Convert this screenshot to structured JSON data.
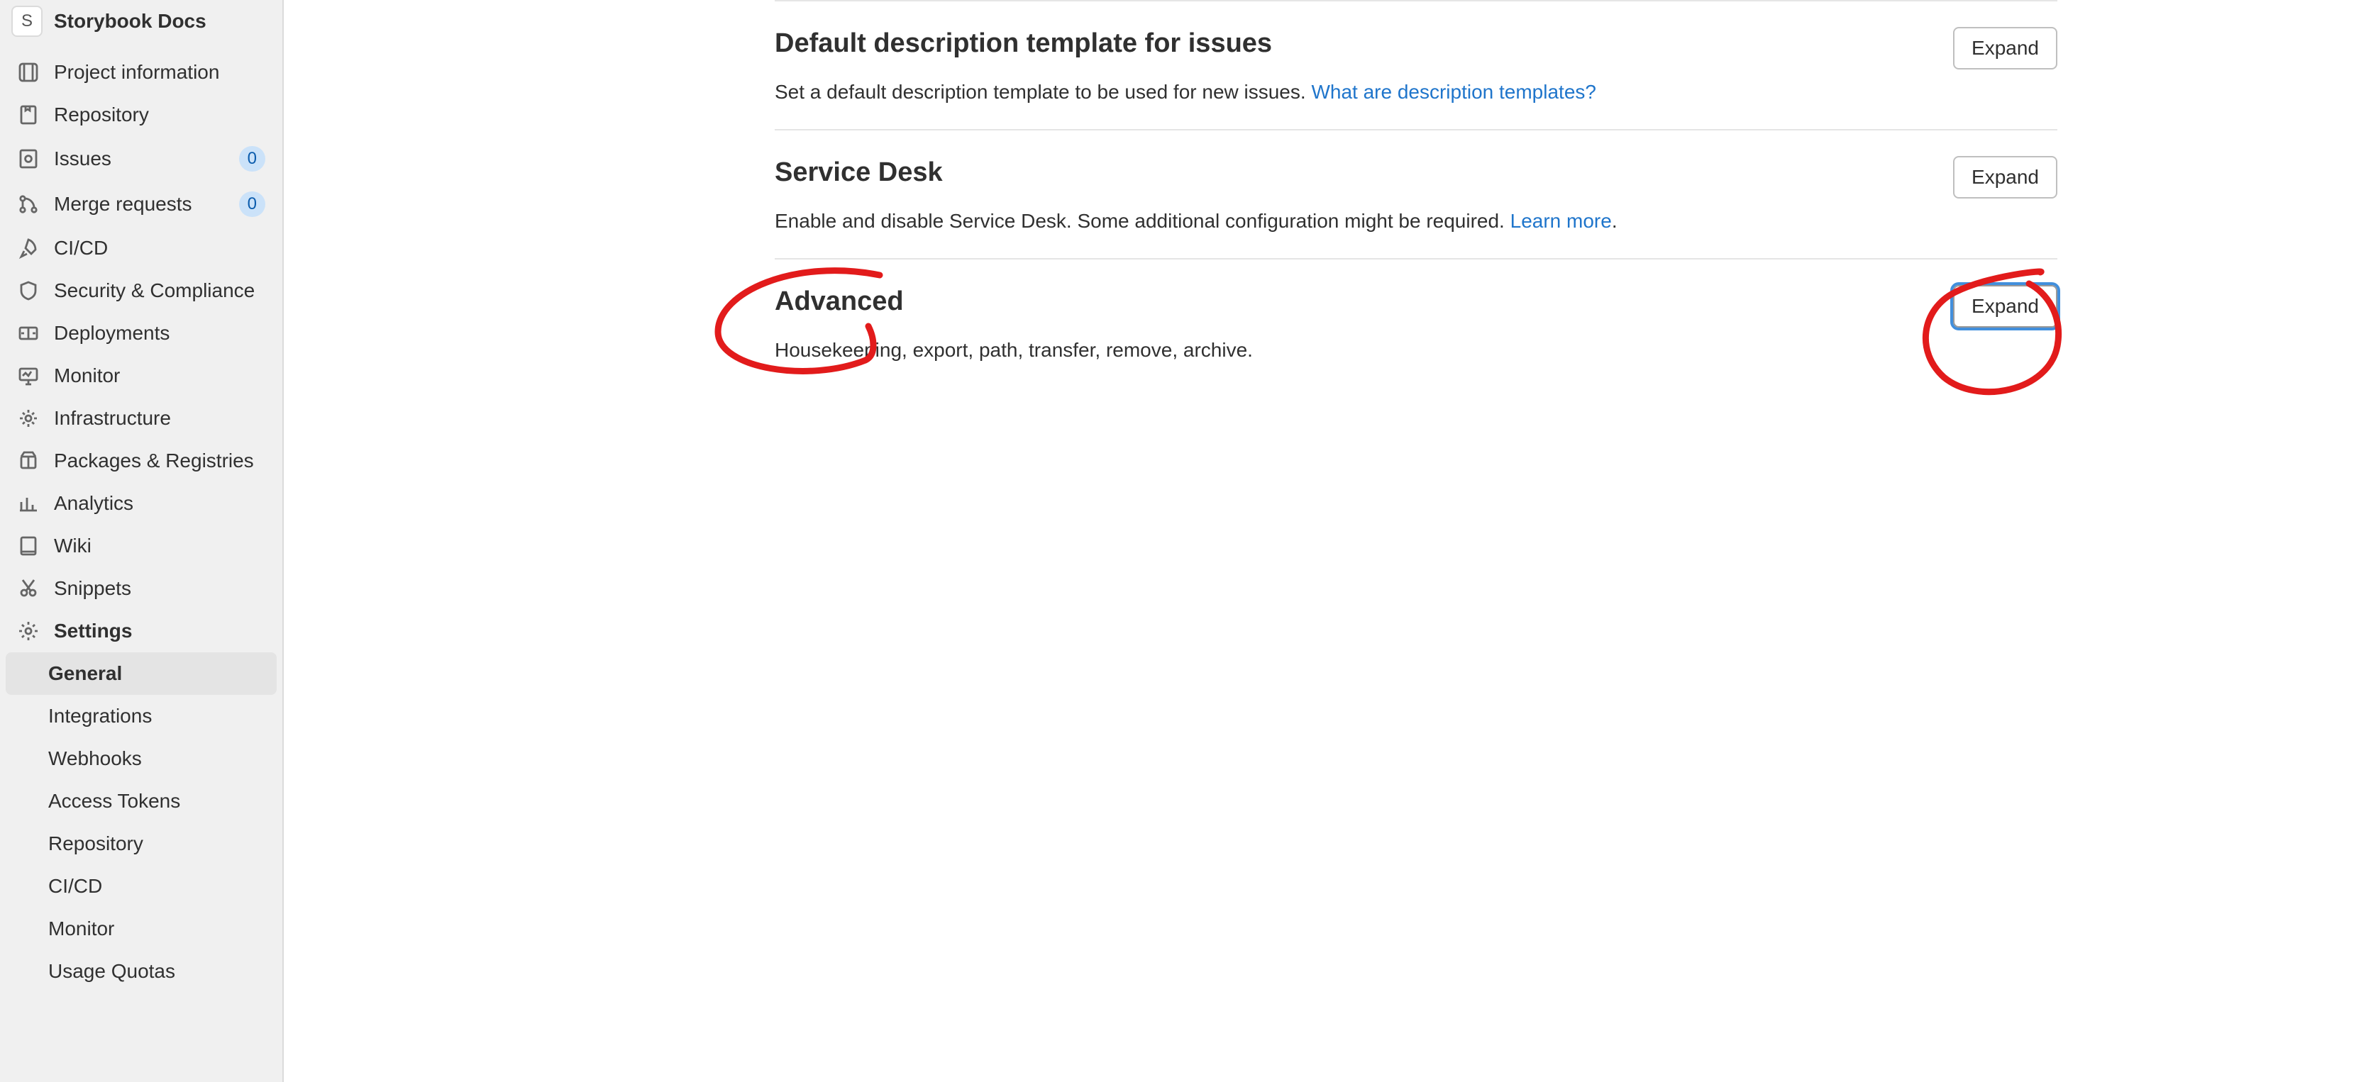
{
  "project": {
    "avatar_letter": "S",
    "name": "Storybook Docs"
  },
  "sidebar": {
    "items": [
      {
        "label": "Project information",
        "icon": "info",
        "badge": null
      },
      {
        "label": "Repository",
        "icon": "repo",
        "badge": null
      },
      {
        "label": "Issues",
        "icon": "issues",
        "badge": "0"
      },
      {
        "label": "Merge requests",
        "icon": "merge",
        "badge": "0"
      },
      {
        "label": "CI/CD",
        "icon": "rocket",
        "badge": null
      },
      {
        "label": "Security & Compliance",
        "icon": "shield",
        "badge": null
      },
      {
        "label": "Deployments",
        "icon": "deploy",
        "badge": null
      },
      {
        "label": "Monitor",
        "icon": "monitor",
        "badge": null
      },
      {
        "label": "Infrastructure",
        "icon": "infra",
        "badge": null
      },
      {
        "label": "Packages & Registries",
        "icon": "package",
        "badge": null
      },
      {
        "label": "Analytics",
        "icon": "analytics",
        "badge": null
      },
      {
        "label": "Wiki",
        "icon": "wiki",
        "badge": null
      },
      {
        "label": "Snippets",
        "icon": "snippets",
        "badge": null
      },
      {
        "label": "Settings",
        "icon": "settings",
        "badge": null,
        "bold": true
      }
    ],
    "settings_children": [
      {
        "label": "General",
        "active": true
      },
      {
        "label": "Integrations",
        "active": false
      },
      {
        "label": "Webhooks",
        "active": false
      },
      {
        "label": "Access Tokens",
        "active": false
      },
      {
        "label": "Repository",
        "active": false
      },
      {
        "label": "CI/CD",
        "active": false
      },
      {
        "label": "Monitor",
        "active": false
      },
      {
        "label": "Usage Quotas",
        "active": false
      }
    ]
  },
  "sections": [
    {
      "title": "Default description template for issues",
      "desc_prefix": "Set a default description template to be used for new issues. ",
      "link_text": "What are description templates?",
      "desc_suffix": "",
      "expand_label": "Expand",
      "focused": false
    },
    {
      "title": "Service Desk",
      "desc_prefix": "Enable and disable Service Desk. Some additional configuration might be required. ",
      "link_text": "Learn more",
      "desc_suffix": ".",
      "expand_label": "Expand",
      "focused": false
    },
    {
      "title": "Advanced",
      "desc_prefix": "Housekeeping, export, path, transfer, remove, archive.",
      "link_text": "",
      "desc_suffix": "",
      "expand_label": "Expand",
      "focused": true
    }
  ]
}
